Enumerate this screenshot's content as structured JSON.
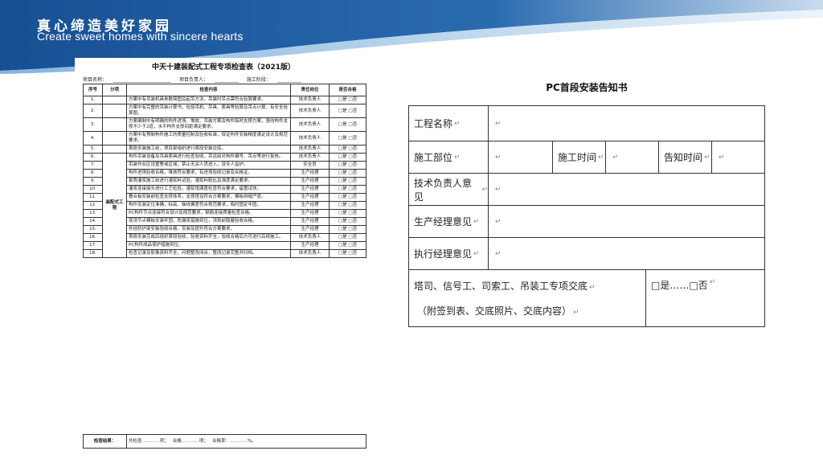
{
  "banner": {
    "slogan_cn": "真心缔造美好家园",
    "slogan_en": "Create sweet homes with sincere hearts",
    "colors": {
      "primary": "#1a5a9e",
      "light": "#5f98cf"
    }
  },
  "checklist": {
    "title": "中天十建装配式工程专项检查表（2021版）",
    "meta": {
      "project_name": "项目名称：",
      "project_manager": "项目负责人：",
      "construction_stage": "施工阶段："
    },
    "headers": [
      "序号",
      "分项",
      "检查内容",
      "责任岗位",
      "是否合格"
    ],
    "category": "装配式工程",
    "rows": [
      {
        "no": "1.",
        "content": "方案中有吊装机具参数简图及起吊方法，吊装时吊点需符合验算要求。",
        "role": "技术负责人",
        "result": "□是 □否"
      },
      {
        "no": "2.",
        "content": "方案中有完整的吊装计算书，包括吊机、吊具、索具等验算及吊点计算，有安全验算图。",
        "role": "技术负责人",
        "result": "□是 □否"
      },
      {
        "no": "3.",
        "content": "方案编制中有明确的构件进场、堆放、吊装方案及构件临时支撑方案，竖向构件支撑不少于2道，水平构件支撑间距满足要求。",
        "role": "技术负责人",
        "result": "□是 □否"
      },
      {
        "no": "4.",
        "content": "方案中有预制构件施工的质量控制及验收标准，保证构件安装精度满足设计及规范要求。",
        "role": "技术负责人",
        "result": "□是 □否"
      },
      {
        "no": "5.",
        "content": "首段安装施工前，项目部组织进行首段安装交底。",
        "role": "技术负责人",
        "result": "□是 □否"
      },
      {
        "no": "6.",
        "content": "构件吊装设备及吊具索具进行检查验收，吊运前对构件编号、吊点等进行复核。",
        "role": "技术负责人",
        "result": "□是 □否"
      },
      {
        "no": "7.",
        "content": "吊装作业区设置警戒区域，禁止无关人员进入，设专人监护。",
        "role": "安全员",
        "result": "□是 □否"
      },
      {
        "no": "8.",
        "content": "构件进场验收合格，堆放符合要求，有进场验收记录及合格证。",
        "role": "生产经理",
        "result": "□是 □否"
      },
      {
        "no": "9.",
        "content": "套筒灌浆施工前进行灌浆料试验，灌浆料配比及强度满足要求。",
        "role": "生产经理",
        "result": "□是 □否"
      },
      {
        "no": "10.",
        "content": "灌浆连接接头进行工艺检验，灌浆饱满度检查符合要求，留置试块。",
        "role": "生产经理",
        "result": "□是 □否"
      },
      {
        "no": "11.",
        "content": "叠合板安装前检查支撑体系，支撑搭设符合方案要求，模板拼缝严密。",
        "role": "生产经理",
        "result": "□是 □否"
      },
      {
        "no": "12.",
        "content": "构件安装定位准确，标高、轴线偏差符合规范要求，临时固定牢固。",
        "role": "生产经理",
        "result": "□是 □否"
      },
      {
        "no": "13.",
        "content": "PC构件节点连接符合设计及规范要求，钢筋连接质量检查合格。",
        "role": "生产经理",
        "result": "□是 □否"
      },
      {
        "no": "14.",
        "content": "现浇节点模板安装牢固，防漏浆措施到位，浇筑前隐蔽验收合格。",
        "role": "生产经理",
        "result": "□是 □否"
      },
      {
        "no": "15.",
        "content": "外挂防护架安装验收合格，安装及提升符合方案要求。",
        "role": "生产经理",
        "result": "□是 □否"
      },
      {
        "no": "16.",
        "content": "首段安装完成后组织首段验收，验收资料齐全，验收合格后方可进行后续施工。",
        "role": "技术负责人",
        "result": "□是 □否"
      },
      {
        "no": "17.",
        "content": "PC构件成品保护措施到位。",
        "role": "生产经理",
        "result": "□是 □否"
      },
      {
        "no": "18.",
        "content": "检查记录及影像资料齐全，问题整改闭合，整改记录完整并归档。",
        "role": "技术负责人",
        "result": "□是 □否"
      }
    ],
    "footer": {
      "label": "检查结果：",
      "total": "共检查…………项；",
      "qualified": "合格…………项；",
      "rate": "合格率：…………%。"
    }
  },
  "notice": {
    "title": "PC首段安装告知书",
    "project_name_label": "工程名称",
    "dept_label": "施工部位",
    "time_label": "施工时间",
    "notify_time_label": "告知时间",
    "tech_label": "技术负责人意见",
    "prod_label": "生产经理意见",
    "exec_label": "执行经理意见",
    "handover_label": "塔司、信号工、司索工、吊装工专项交底",
    "handover_note": "（附签到表、交底照片、交底内容）",
    "yes_no": "□是……□否",
    "para_mark": "↵"
  }
}
